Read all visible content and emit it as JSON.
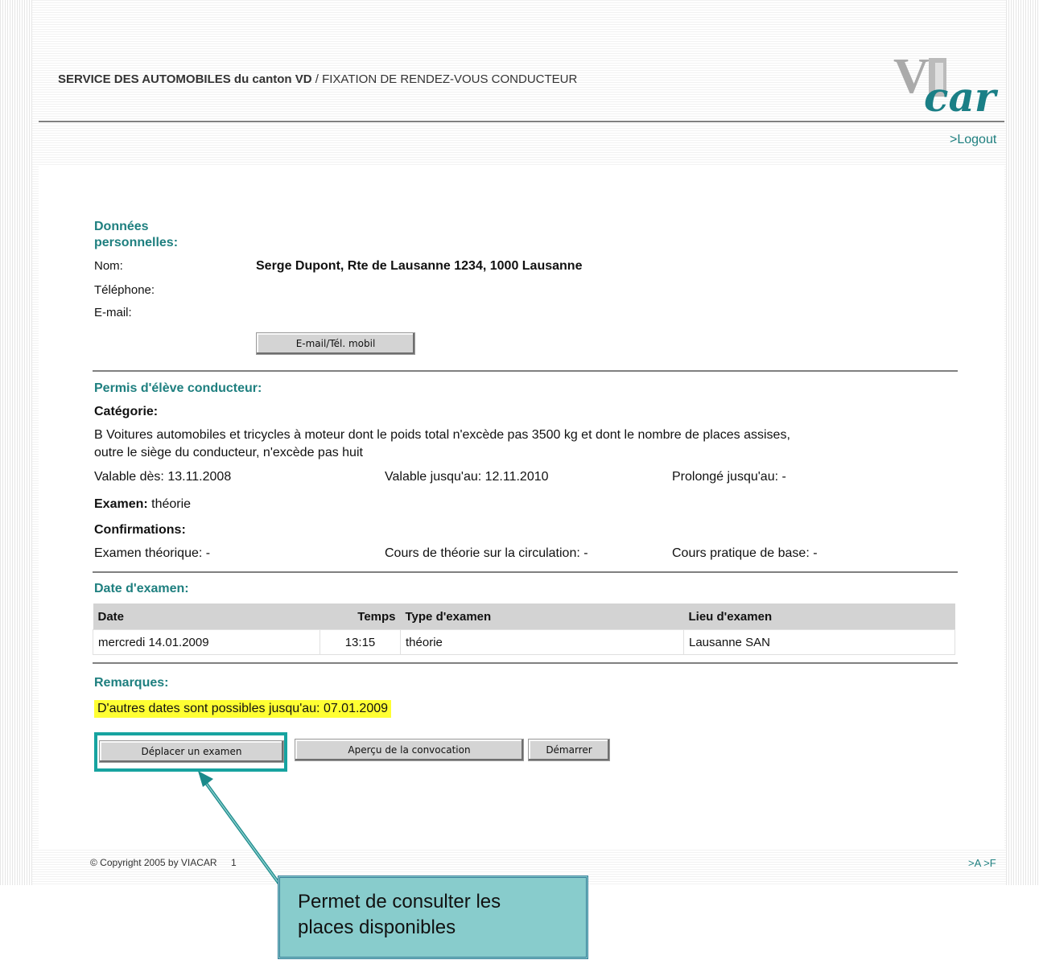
{
  "header": {
    "title_bold": "SERVICE DES AUTOMOBILES du canton VD",
    "title_rest": " / FIXATION DE RENDEZ-VOUS CONDUCTEUR",
    "logo_text": "VIACar",
    "logout": ">Logout"
  },
  "personal": {
    "title_line1": "Données",
    "title_line2": "personnelles:",
    "name_label": "Nom:",
    "name_value": "Serge Dupont, Rte de Lausanne 1234, 1000 Lausanne",
    "phone_label": "Téléphone:",
    "email_label": "E-mail:",
    "button": "E-mail/Tél. mobil"
  },
  "permit": {
    "title": "Permis d'élève conducteur:",
    "category_label": "Catégorie:",
    "category_text_1": "B Voitures automobiles et tricycles à moteur dont le poids total n'excède pas 3500 kg et dont le nombre de places assises,",
    "category_text_2": "outre le siège du conducteur, n'excède pas huit",
    "valid_from": "Valable dès: 13.11.2008",
    "valid_until": "Valable jusqu'au: 12.11.2010",
    "extended_until": "Prolongé jusqu'au: -",
    "exam_label": "Examen:",
    "exam_value": "théorie",
    "confirmations_label": "Confirmations:",
    "conf_theory_exam": "Examen théorique: -",
    "conf_theory_course": "Cours de théorie sur la circulation: -",
    "conf_practical": "Cours pratique de base: -"
  },
  "exam_date": {
    "title": "Date d'examen:",
    "columns": [
      "Date",
      "Temps",
      "Type d'examen",
      "Lieu d'examen"
    ],
    "rows": [
      [
        "mercredi 14.01.2009",
        "13:15",
        "théorie",
        "Lausanne SAN"
      ]
    ]
  },
  "remarks": {
    "title": "Remarques:",
    "text": "D'autres dates sont possibles jusqu'au: 07.01.2009"
  },
  "actions": {
    "move_exam": "Déplacer un examen",
    "preview": "Aperçu de la convocation",
    "start": "Démarrer"
  },
  "footer": {
    "copyright": "© Copyright 2005 by VIACAR",
    "version_digit": "1",
    "links": ">A >F"
  },
  "callout": {
    "line1": "Permet de consulter les",
    "line2": "places disponibles"
  },
  "colors": {
    "accent": "#1e7f7f",
    "highlight": "#ffff33",
    "callout_bg": "#88cccc",
    "box": "#17a3a0"
  }
}
